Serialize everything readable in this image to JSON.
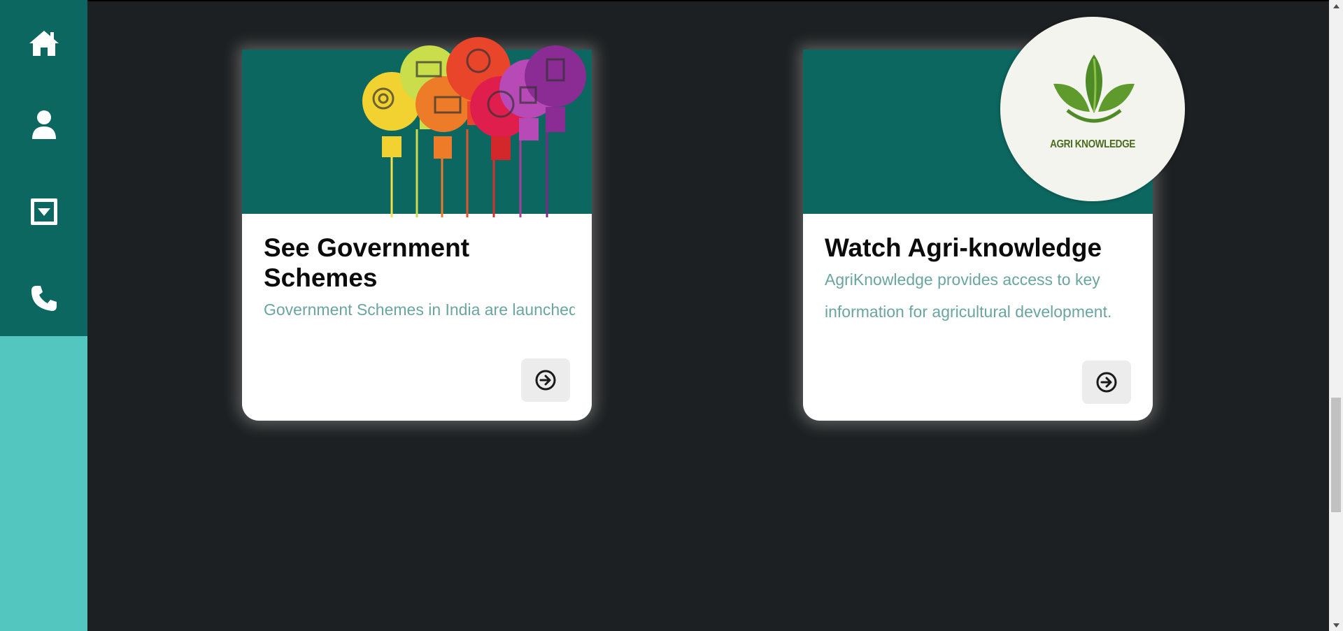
{
  "sidebar": {
    "items": [
      {
        "icon": "home-icon"
      },
      {
        "icon": "user-icon"
      },
      {
        "icon": "dropdown-box-icon"
      },
      {
        "icon": "phone-icon"
      }
    ]
  },
  "cards": [
    {
      "title": "See Government Schemes",
      "description": "Government Schemes in India are launched by the government to addres",
      "button_icon": "arrow-circle-right-icon"
    },
    {
      "title": "Watch Agri-knowledge",
      "description": "AgriKnowledge provides access to key information for agricultural development.",
      "logo_text": "AGRI KNOWLEDGE",
      "button_icon": "arrow-circle-right-icon"
    }
  ],
  "colors": {
    "page_bg": "#1d2022",
    "sidebar_nav": "#0c6760",
    "sidebar_bg": "#53c6bf",
    "card_header": "#0c6760",
    "description_text": "#6aa5a0"
  }
}
